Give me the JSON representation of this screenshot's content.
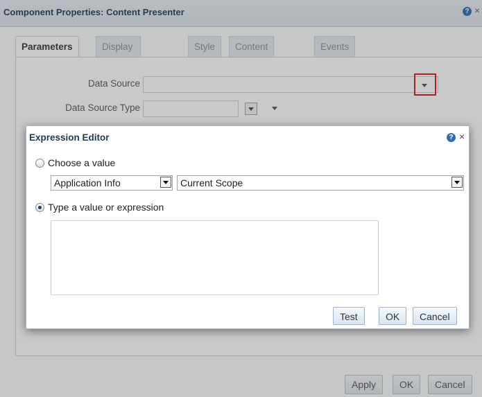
{
  "background_dialog": {
    "title": "Component Properties: Content Presenter",
    "help_icon": "?",
    "close_icon": "×",
    "tabs": [
      {
        "label": "Parameters",
        "active": true
      },
      {
        "label": "Display Options",
        "active": false
      },
      {
        "label": "Style",
        "active": false
      },
      {
        "label": "Content Style",
        "active": false
      },
      {
        "label": "Events",
        "active": false
      }
    ],
    "fields": {
      "data_source_label": "Data Source",
      "data_source_type_label": "Data Source Type"
    },
    "buttons": {
      "apply": "Apply",
      "ok": "OK",
      "cancel": "Cancel"
    }
  },
  "expression_editor": {
    "title": "Expression Editor",
    "help_icon": "?",
    "close_icon": "×",
    "choose_value_label": "Choose a value",
    "choose_value_checked": false,
    "category_select": "Application Info",
    "scope_select": "Current Scope",
    "type_value_label": "Type a value or expression",
    "type_value_checked": true,
    "expression_value": "",
    "buttons": {
      "test": "Test",
      "ok": "OK",
      "cancel": "Cancel"
    }
  },
  "colors": {
    "title_text": "#1f3a5a",
    "help_icon": "#2f6db5",
    "highlight_box": "#d21b1b",
    "radio_selected": "#1b3d7a"
  }
}
